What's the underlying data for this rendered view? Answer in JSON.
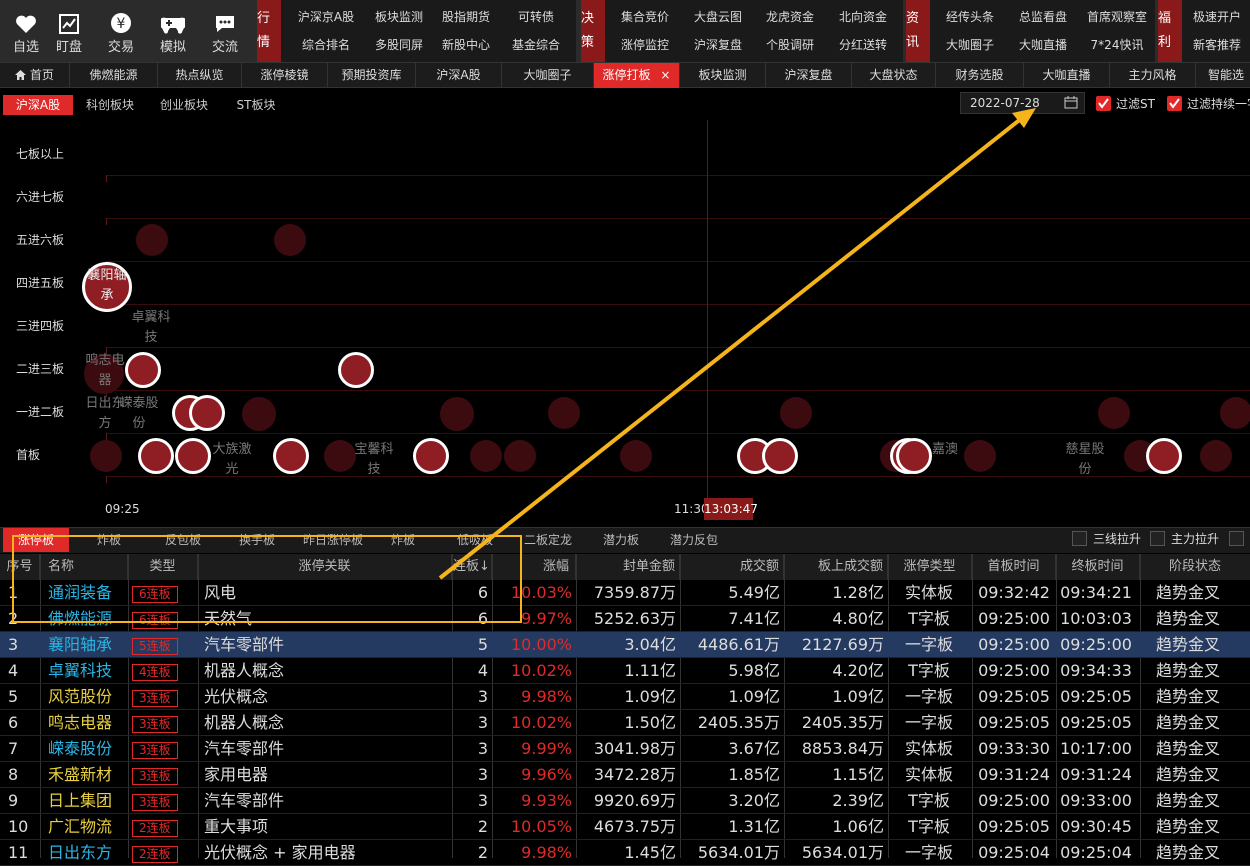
{
  "top_icons": [
    {
      "label": "自选",
      "icon": "heart-icon"
    },
    {
      "label": "盯盘",
      "icon": "chart-icon"
    },
    {
      "label": "交易",
      "icon": "yen-icon"
    },
    {
      "label": "模拟",
      "icon": "gamepad-icon"
    },
    {
      "label": "交流",
      "icon": "chat-icon"
    }
  ],
  "menu_groups": [
    {
      "category": "行情",
      "items": [
        [
          "沪深京A股",
          "板块监测",
          "股指期货",
          "可转债"
        ],
        [
          "综合排名",
          "多股同屏",
          "新股中心",
          "基金综合"
        ]
      ]
    },
    {
      "category": "决策",
      "items": [
        [
          "集合竞价",
          "大盘云图",
          "龙虎资金",
          "北向资金"
        ],
        [
          "涨停监控",
          "沪深复盘",
          "个股调研",
          "分红送转"
        ]
      ]
    },
    {
      "category": "资讯",
      "items": [
        [
          "经传头条",
          "总监看盘",
          "首席观察室"
        ],
        [
          "大咖圈子",
          "大咖直播",
          "7*24快讯"
        ]
      ]
    },
    {
      "category": "福利",
      "items": [
        [
          "极速开户"
        ],
        [
          "新客推荐"
        ]
      ]
    }
  ],
  "tabs": [
    "首页",
    "佛燃能源",
    "热点纵览",
    "涨停棱镜",
    "预期投资库",
    "沪深A股",
    "大咖圈子",
    "涨停打板",
    "板块监测",
    "沪深复盘",
    "大盘状态",
    "财务选股",
    "大咖直播",
    "主力风格",
    "智能选"
  ],
  "active_tab": "涨停打板",
  "market_tabs": [
    "沪深A股",
    "科创板块",
    "创业板块",
    "ST板块"
  ],
  "date": "2022-07-28",
  "filters": [
    "过滤ST",
    "过滤持续一字"
  ],
  "chart": {
    "rows": [
      "七板以上",
      "六进七板",
      "五进六板",
      "四进五板",
      "三进四板",
      "二进三板",
      "一进二板",
      "首板"
    ],
    "labels": [
      {
        "text": "襄阳轴承",
        "row": 3
      },
      {
        "text": "卓翼科技",
        "row": 4
      },
      {
        "text": "鸣志电器",
        "row": 5
      },
      {
        "text": "日出东方",
        "row": 6
      },
      {
        "text": "嵘泰股份",
        "row": 6
      },
      {
        "text": "大族激光",
        "row": 7
      },
      {
        "text": "宝馨科技",
        "row": 7
      },
      {
        "text": "嘉澳",
        "row": 7
      },
      {
        "text": "慈星股份",
        "row": 7
      }
    ],
    "time_start": "09:25",
    "time_mid": "11:30",
    "time_cursor": "13:03:47"
  },
  "bottom_tabs": [
    "涨停板",
    "炸板",
    "反包板",
    "换手板",
    "昨日涨停板",
    "炸板",
    "低吸板",
    "二板定龙",
    "潜力板",
    "潜力反包"
  ],
  "bottom_filters": [
    "三线拉升",
    "主力拉升"
  ],
  "table": {
    "headers": [
      "序号",
      "名称",
      "类型",
      "涨停关联",
      "连板↓",
      "涨幅",
      "封单金额",
      "成交额",
      "板上成交额",
      "涨停类型",
      "首板时间",
      "终板时间",
      "阶段状态"
    ],
    "rows": [
      {
        "no": "1",
        "name": "通润装备",
        "name_color": "#29b6e6",
        "type": "6连板",
        "rel": "风电",
        "lb": "6",
        "zf": "10.03%",
        "fd": "7359.87万",
        "cj": "5.49亿",
        "bs": "1.28亿",
        "zt": "实体板",
        "sb": "09:32:42",
        "zb": "09:34:21",
        "jd": "趋势金叉"
      },
      {
        "no": "2",
        "name": "佛燃能源",
        "name_color": "#29b6e6",
        "type": "6连板",
        "rel": "天然气",
        "lb": "6",
        "zf": "9.97%",
        "fd": "5252.63万",
        "cj": "7.41亿",
        "bs": "4.80亿",
        "zt": "T字板",
        "sb": "09:25:00",
        "zb": "10:03:03",
        "jd": "趋势金叉"
      },
      {
        "no": "3",
        "name": "襄阳轴承",
        "name_color": "#29b6e6",
        "type": "5连板",
        "rel": "汽车零部件",
        "lb": "5",
        "zf": "10.00%",
        "fd": "3.04亿",
        "cj": "4486.61万",
        "bs": "2127.69万",
        "zt": "一字板",
        "sb": "09:25:00",
        "zb": "09:25:00",
        "jd": "趋势金叉",
        "selected": true
      },
      {
        "no": "4",
        "name": "卓翼科技",
        "name_color": "#29b6e6",
        "type": "4连板",
        "rel": "机器人概念",
        "lb": "4",
        "zf": "10.02%",
        "fd": "1.11亿",
        "cj": "5.98亿",
        "bs": "4.20亿",
        "zt": "T字板",
        "sb": "09:25:00",
        "zb": "09:34:33",
        "jd": "趋势金叉"
      },
      {
        "no": "5",
        "name": "风范股份",
        "name_color": "#e8d040",
        "type": "3连板",
        "rel": "光伏概念",
        "lb": "3",
        "zf": "9.98%",
        "fd": "1.09亿",
        "cj": "1.09亿",
        "bs": "1.09亿",
        "zt": "一字板",
        "sb": "09:25:05",
        "zb": "09:25:05",
        "jd": "趋势金叉"
      },
      {
        "no": "6",
        "name": "鸣志电器",
        "name_color": "#e8d040",
        "type": "3连板",
        "rel": "机器人概念",
        "lb": "3",
        "zf": "10.02%",
        "fd": "1.50亿",
        "cj": "2405.35万",
        "bs": "2405.35万",
        "zt": "一字板",
        "sb": "09:25:05",
        "zb": "09:25:05",
        "jd": "趋势金叉"
      },
      {
        "no": "7",
        "name": "嵘泰股份",
        "name_color": "#29b6e6",
        "type": "3连板",
        "rel": "汽车零部件",
        "lb": "3",
        "zf": "9.99%",
        "fd": "3041.98万",
        "cj": "3.67亿",
        "bs": "8853.84万",
        "zt": "实体板",
        "sb": "09:33:30",
        "zb": "10:17:00",
        "jd": "趋势金叉"
      },
      {
        "no": "8",
        "name": "禾盛新材",
        "name_color": "#e8d040",
        "type": "3连板",
        "rel": "家用电器",
        "lb": "3",
        "zf": "9.96%",
        "fd": "3472.28万",
        "cj": "1.85亿",
        "bs": "1.15亿",
        "zt": "实体板",
        "sb": "09:31:24",
        "zb": "09:31:24",
        "jd": "趋势金叉"
      },
      {
        "no": "9",
        "name": "日上集团",
        "name_color": "#e8d040",
        "type": "3连板",
        "rel": "汽车零部件",
        "lb": "3",
        "zf": "9.93%",
        "fd": "9920.69万",
        "cj": "3.20亿",
        "bs": "2.39亿",
        "zt": "T字板",
        "sb": "09:25:00",
        "zb": "09:33:00",
        "jd": "趋势金叉"
      },
      {
        "no": "10",
        "name": "广汇物流",
        "name_color": "#e8d040",
        "type": "2连板",
        "rel": "重大事项",
        "lb": "2",
        "zf": "10.05%",
        "fd": "4673.75万",
        "cj": "1.31亿",
        "bs": "1.06亿",
        "zt": "T字板",
        "sb": "09:25:05",
        "zb": "09:30:45",
        "jd": "趋势金叉"
      },
      {
        "no": "11",
        "name": "日出东方",
        "name_color": "#29b6e6",
        "type": "2连板",
        "rel": "光伏概念 + 家用电器",
        "lb": "2",
        "zf": "9.98%",
        "fd": "1.45亿",
        "cj": "5634.01万",
        "bs": "5634.01万",
        "zt": "一字板",
        "sb": "09:25:04",
        "zb": "09:25:04",
        "jd": "趋势金叉"
      }
    ]
  },
  "colors": {
    "accent": "#e02a2a",
    "annotation": "#f4b41a",
    "bubble": "#8f1d24"
  }
}
